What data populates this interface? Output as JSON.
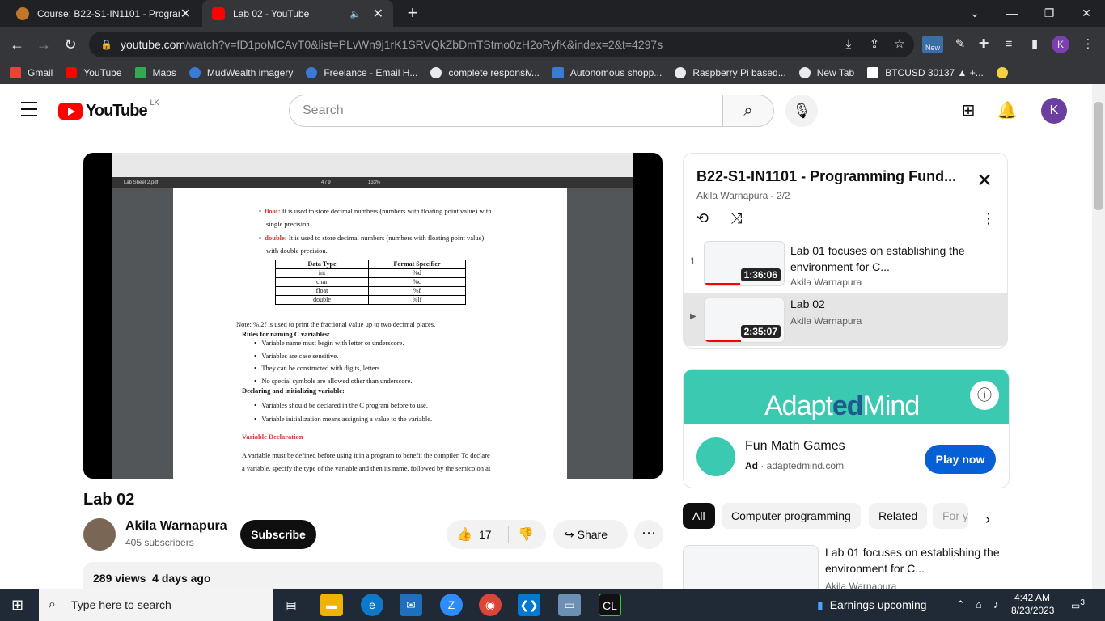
{
  "browser": {
    "tabs": [
      {
        "title": "Course: B22-S1-IN1101 - Program",
        "active": false
      },
      {
        "title": "Lab 02 - YouTube",
        "active": true
      }
    ],
    "url_host": "youtube.com",
    "url_path": "/watch?v=fD1poMCAvT0&list=PLvWn9j1rK1SRVQkZbDmTStmo0zH2oRyfK&index=2&t=4297s",
    "bookmarks": [
      "Gmail",
      "YouTube",
      "Maps",
      "MudWealth imagery",
      "Freelance - Email H...",
      "complete responsiv...",
      "Autonomous shopp...",
      "Raspberry Pi based...",
      "New Tab",
      "BTCUSD 30137 ▲ +..."
    ],
    "profile_initial": "K"
  },
  "youtube": {
    "logo_text": "YouTube",
    "country_code": "LK",
    "search_placeholder": "Search",
    "avatar_initial": "K"
  },
  "pdf": {
    "filename": "Lab Sheet 2.pdf",
    "page": "4 / 9",
    "zoom": "133%",
    "lines": {
      "float_label": "float:",
      "float_text": "It is used to store decimal numbers (numbers with floating point value) with",
      "float_text2": "single precision.",
      "double_label": "double:",
      "double_text": "It is used to store decimal numbers (numbers with floating point value)",
      "double_text2": "with double precision.",
      "note": "Note:  %.2f is used to print the fractional value up to two decimal places.",
      "rules_head": "Rules for naming C variables:",
      "rule1": "Variable name must begin with letter or underscore.",
      "rule2": "Variables are case sensitive.",
      "rule3": "They can be constructed with digits, letters.",
      "rule4": "No special symbols are allowed other than underscore.",
      "decl_head": "Declaring and initializing variable:",
      "decl1": "Variables should be declared in the C program before to use.",
      "decl2": "Variable initialization means assigning a value to the variable.",
      "vardecl_head": "Variable Declaration",
      "para1": "A variable must be defined before using it in a program to benefit the compiler. To declare",
      "para2": "a variable, specify the type of the variable and then its name, followed by the semicolon at"
    },
    "table": {
      "headers": [
        "Data Type",
        "Format Specifier"
      ],
      "rows": [
        [
          "int",
          "%d"
        ],
        [
          "char",
          "%c"
        ],
        [
          "float",
          "%f"
        ],
        [
          "double",
          "%lf"
        ]
      ]
    }
  },
  "video": {
    "title": "Lab 02",
    "channel": "Akila Warnapura",
    "subscribers": "405 subscribers",
    "subscribe_label": "Subscribe",
    "likes": "17",
    "share_label": "Share",
    "views": "289 views",
    "age": "4 days ago"
  },
  "playlist": {
    "title": "B22-S1-IN1101 - Programming Fund...",
    "meta": "Akila Warnapura - 2/2",
    "items": [
      {
        "index": "1",
        "title": "Lab 01 focuses on establishing the environment for C...",
        "channel": "Akila Warnapura",
        "duration": "1:36:06",
        "progress": 0.45
      },
      {
        "index": "▶",
        "title": "Lab 02",
        "channel": "Akila Warnapura",
        "duration": "2:35:07",
        "progress": 0.46
      }
    ]
  },
  "ad": {
    "brand_a": "Adapt",
    "brand_b": "ed",
    "brand_c": "Mind",
    "title": "Fun Math Games",
    "label": "Ad",
    "domain": "adaptedmind.com",
    "cta": "Play now"
  },
  "chips": [
    "All",
    "Computer programming",
    "Related",
    "For y"
  ],
  "recommended": [
    {
      "title": "Lab 01 focuses on establishing the environment for C...",
      "channel": "Akila Warnapura"
    }
  ],
  "taskbar": {
    "search_placeholder": "Type here to search",
    "widget": "Earnings upcoming",
    "time": "4:42 AM",
    "date": "8/23/2023",
    "notifications": "3"
  }
}
